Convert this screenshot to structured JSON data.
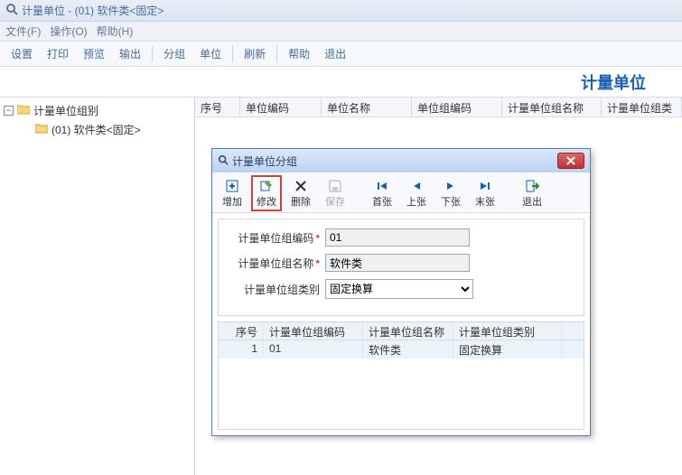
{
  "window": {
    "title": "计量单位 - (01) 软件类<固定>"
  },
  "menubar": {
    "file": "文件(F)",
    "action": "操作(O)",
    "help": "帮助(H)"
  },
  "toolbar": {
    "settings": "设置",
    "print": "打印",
    "preview": "预览",
    "output": "输出",
    "group": "分组",
    "unit": "单位",
    "refresh": "刷新",
    "help2": "帮助",
    "exit": "退出"
  },
  "banner": {
    "title": "计量单位"
  },
  "tree": {
    "root": {
      "label": "计量单位组别"
    },
    "child": {
      "label": "(01) 软件类<固定>"
    }
  },
  "grid": {
    "cols": {
      "seq": "序号",
      "code": "单位编码",
      "name": "单位名称",
      "gcode": "单位组编码",
      "gname": "计量单位组名称",
      "gtype": "计量单位组类"
    }
  },
  "dialog": {
    "title": "计量单位分组",
    "toolbar": {
      "add": "增加",
      "edit": "修改",
      "del": "删除",
      "save": "保存",
      "first": "首张",
      "prev": "上张",
      "next": "下张",
      "last": "末张",
      "exit": "退出"
    },
    "form": {
      "code_label": "计量单位组编码",
      "code_value": "01",
      "name_label": "计量单位组名称",
      "name_value": "软件类",
      "type_label": "计量单位组类别",
      "type_value": "固定换算"
    },
    "grid": {
      "cols": {
        "seq": "序号",
        "code": "计量单位组编码",
        "name": "计量单位组名称",
        "type": "计量单位组类别"
      },
      "rows": [
        {
          "seq": "1",
          "code": "01",
          "name": "软件类",
          "type": "固定换算"
        }
      ]
    }
  }
}
